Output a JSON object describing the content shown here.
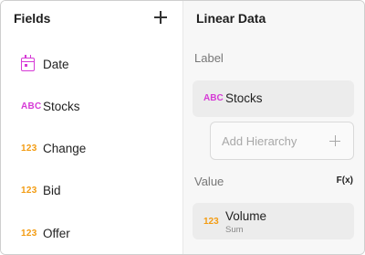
{
  "fields_panel": {
    "title": "Fields",
    "items": [
      {
        "type": "date",
        "icon": "calendar-icon",
        "label": "Date"
      },
      {
        "type": "text",
        "icon_text": "ABC",
        "label": "Stocks"
      },
      {
        "type": "number",
        "icon_text": "123",
        "label": "Change"
      },
      {
        "type": "number",
        "icon_text": "123",
        "label": "Bid"
      },
      {
        "type": "number",
        "icon_text": "123",
        "label": "Offer"
      }
    ]
  },
  "config_panel": {
    "title": "Linear Data",
    "label_section": {
      "title": "Label",
      "chip": {
        "icon_text": "ABC",
        "label": "Stocks"
      },
      "add_hierarchy": "Add Hierarchy"
    },
    "value_section": {
      "title": "Value",
      "fx": "F(x)",
      "chip": {
        "icon_text": "123",
        "label": "Volume",
        "sublabel": "Sum"
      }
    }
  },
  "colors": {
    "text_type": "#d63ad6",
    "number_type": "#f39c12",
    "chip_bg": "#ececec"
  }
}
